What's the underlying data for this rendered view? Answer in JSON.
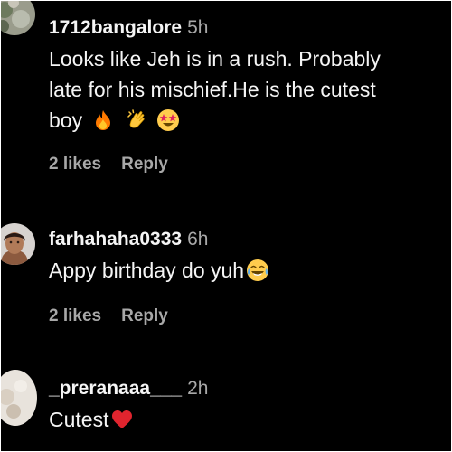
{
  "comments": [
    {
      "username": "1712bangalore",
      "time": "5h",
      "text_lines": [
        "Looks like Jeh is in a rush. Probably",
        "late for his mischief.He is the cutest",
        "boy"
      ],
      "emojis": [
        "fire-emoji",
        "clapping-hands-emoji",
        "star-struck-emoji"
      ],
      "likes": "2 likes",
      "reply": "Reply"
    },
    {
      "username": "farhahaha0333",
      "time": "6h",
      "text": "Appy birthday do yuh",
      "emojis": [
        "tears-of-joy-emoji"
      ],
      "likes": "2 likes",
      "reply": "Reply"
    },
    {
      "username": "_preranaaa___",
      "time": "2h",
      "text": "Cutest",
      "emojis": [
        "red-heart-emoji"
      ]
    }
  ],
  "colors": {
    "background": "#000000",
    "primary_text": "#f5f5f5",
    "secondary_text": "#a8a8a8",
    "heart": "#e0242e",
    "fire": "#ff7a00"
  }
}
